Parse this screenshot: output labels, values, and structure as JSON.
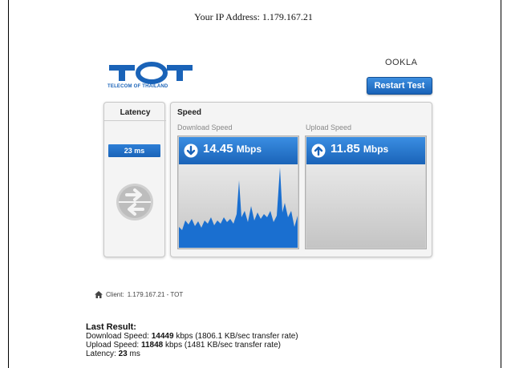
{
  "header": {
    "ip_label": "Your IP Address:",
    "ip_value": "1.179.167.21"
  },
  "branding": {
    "logo_text": "TOT",
    "tagline": "TELECOM OF THAILAND",
    "provider": "OOKLA",
    "brand_color": "#1a63b8"
  },
  "actions": {
    "restart_label": "Restart Test"
  },
  "latency": {
    "title": "Latency",
    "value": "23 ms",
    "icon": "arrows-circle-icon"
  },
  "speed": {
    "title": "Speed",
    "download_label": "Download Speed",
    "upload_label": "Upload Speed",
    "download_value": "14.45",
    "upload_value": "11.85",
    "unit": "Mbps",
    "download_icon": "arrow-down-circle-icon",
    "upload_icon": "arrow-up-circle-icon"
  },
  "client": {
    "label": "Client:",
    "value": "1.179.167.21 - TOT",
    "icon": "home-icon"
  },
  "last_result": {
    "title": "Last Result:",
    "download_prefix": "Download Speed:",
    "download_kbps": "14449",
    "download_suffix": "kbps (1806.1 KB/sec transfer rate)",
    "upload_prefix": "Upload Speed:",
    "upload_kbps": "11848",
    "upload_suffix": "kbps (1481 KB/sec transfer rate)",
    "latency_prefix": "Latency:",
    "latency_value": "23",
    "latency_unit": "ms"
  }
}
